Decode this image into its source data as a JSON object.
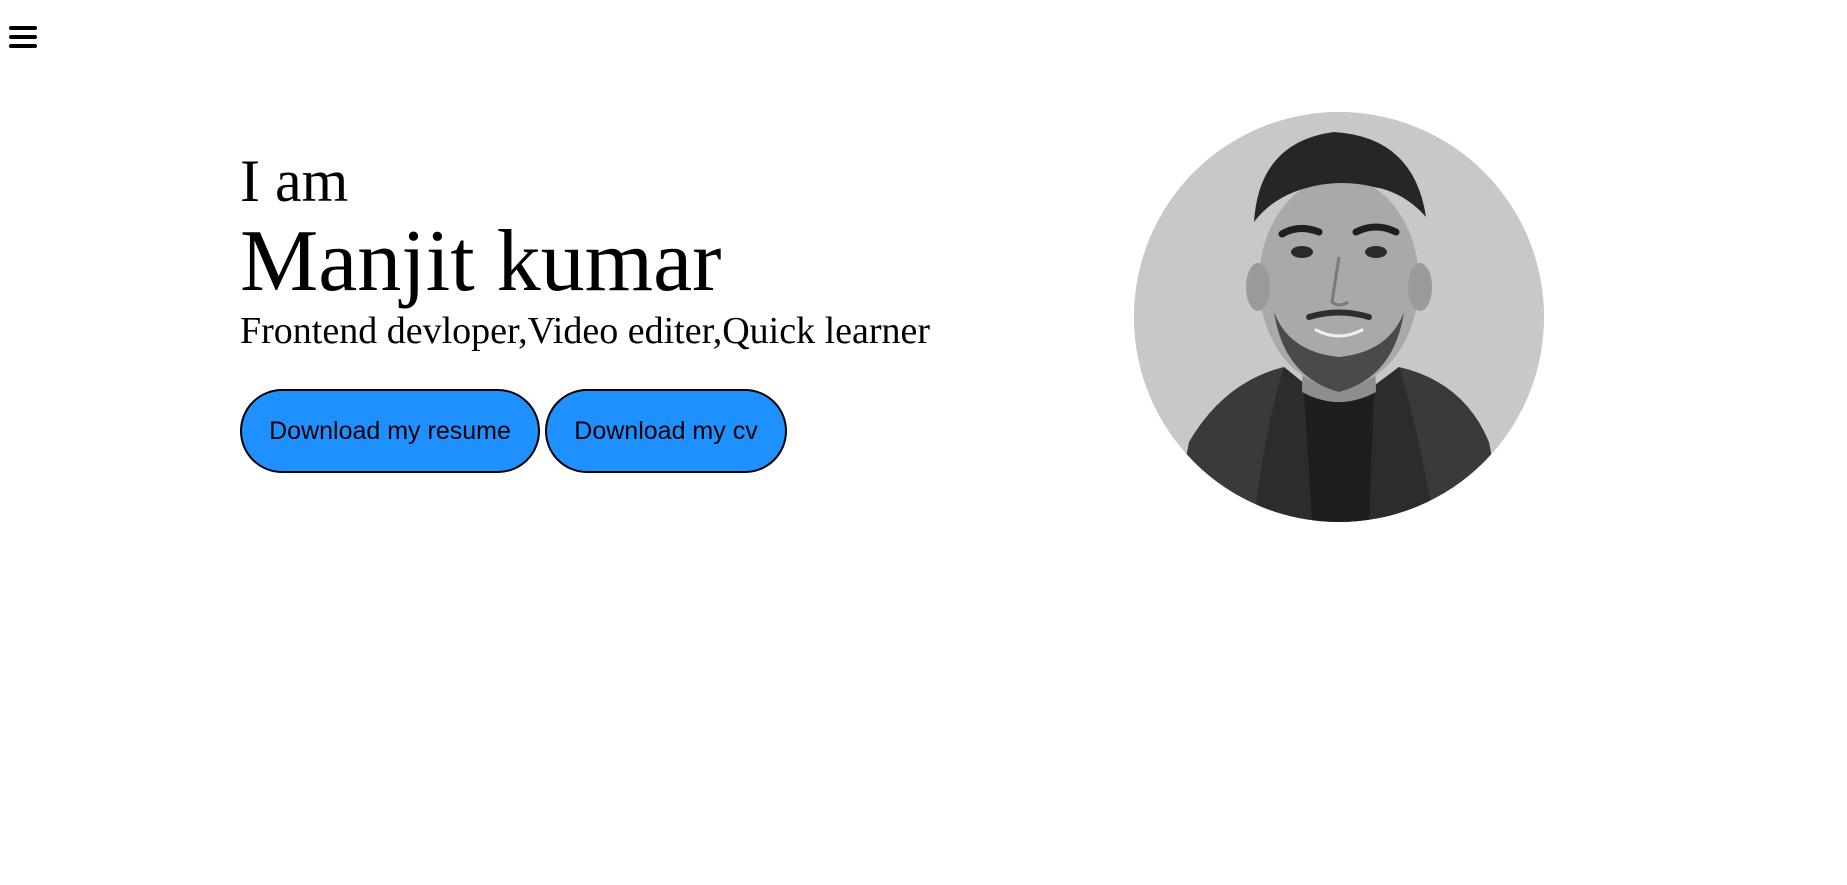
{
  "nav": {
    "menu_icon": "hamburger-menu-icon"
  },
  "hero": {
    "greeting": "I am",
    "name": "Manjit kumar",
    "roles": "Frontend devloper,Video editer,Quick learner",
    "buttons": {
      "resume_label": "Download my resume",
      "cv_label": "Download my cv"
    },
    "avatar": "profile-photo",
    "colors": {
      "button_bg": "#1e90ff",
      "avatar_bg": "#c8c8c8"
    }
  }
}
